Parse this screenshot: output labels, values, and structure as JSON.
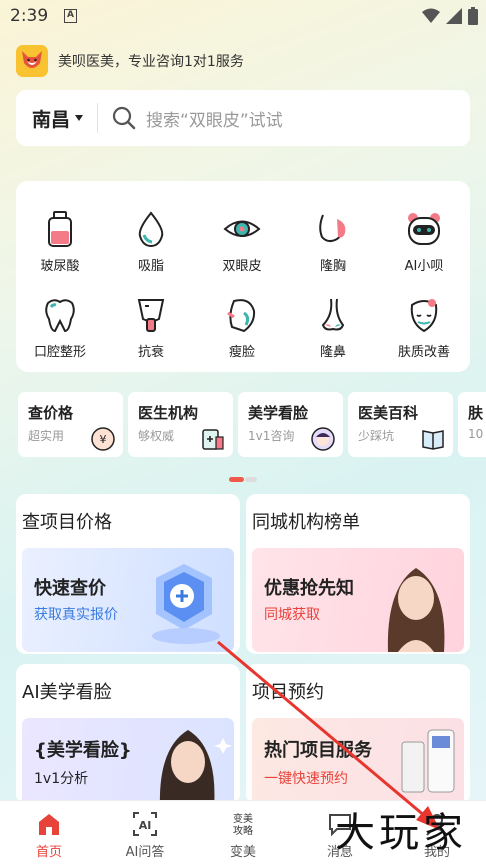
{
  "status": {
    "time": "2:39",
    "notif_badge": "A"
  },
  "brand": {
    "tagline": "美呗医美，专业咨询1对1服务"
  },
  "search": {
    "city": "南昌",
    "placeholder": "搜索“双眼皮”试试"
  },
  "categories": [
    {
      "label": "玻尿酸",
      "icon": "hyaluronic-bottle-icon"
    },
    {
      "label": "吸脂",
      "icon": "fat-drop-icon"
    },
    {
      "label": "双眼皮",
      "icon": "eye-icon"
    },
    {
      "label": "隆胸",
      "icon": "chest-icon"
    },
    {
      "label": "AI小呗",
      "icon": "ai-robot-icon"
    },
    {
      "label": "口腔整形",
      "icon": "tooth-icon"
    },
    {
      "label": "抗衰",
      "icon": "anti-aging-cup-icon"
    },
    {
      "label": "瘦脸",
      "icon": "face-slim-icon"
    },
    {
      "label": "隆鼻",
      "icon": "nose-icon"
    },
    {
      "label": "肤质改善",
      "icon": "skin-face-icon"
    }
  ],
  "quick": [
    {
      "title": "查价格",
      "sub": "超实用",
      "icon": "price-icon"
    },
    {
      "title": "医生机构",
      "sub": "够权威",
      "icon": "clinic-icon"
    },
    {
      "title": "美学看脸",
      "sub": "1v1咨询",
      "icon": "face-avatar-icon"
    },
    {
      "title": "医美百科",
      "sub": "少踩坑",
      "icon": "book-icon"
    },
    {
      "title": "肤",
      "sub": "10",
      "icon": "skin-icon"
    }
  ],
  "panels": [
    {
      "title": "查项目价格",
      "banner_title": "快速查价",
      "banner_sub": "获取真实报价"
    },
    {
      "title": "同城机构榜单",
      "banner_title": "优惠抢先知",
      "banner_sub": "同城获取"
    },
    {
      "title": "AI美学看脸",
      "banner_title": "{美学看脸}",
      "banner_sub": "1v1分析"
    },
    {
      "title": "项目预约",
      "banner_title": "热门项目服务",
      "banner_sub": "一键快速预约"
    }
  ],
  "tabs": [
    {
      "label": "首页",
      "icon": "home-icon",
      "active": true
    },
    {
      "label": "AI问答",
      "icon": "ai-qa-icon",
      "active": false
    },
    {
      "label": "变美",
      "icon": "beauty-strategy-icon",
      "icon_text": "变美\n攻略",
      "active": false
    },
    {
      "label": "消息",
      "icon": "message-icon",
      "active": false
    },
    {
      "label": "我的",
      "icon": "profile-icon",
      "active": false
    }
  ],
  "watermark": "大玩家",
  "colors": {
    "accent": "#e8433b",
    "brand_yellow": "#f8c230",
    "teal": "#3fb6ad",
    "pink": "#f06a7a"
  }
}
